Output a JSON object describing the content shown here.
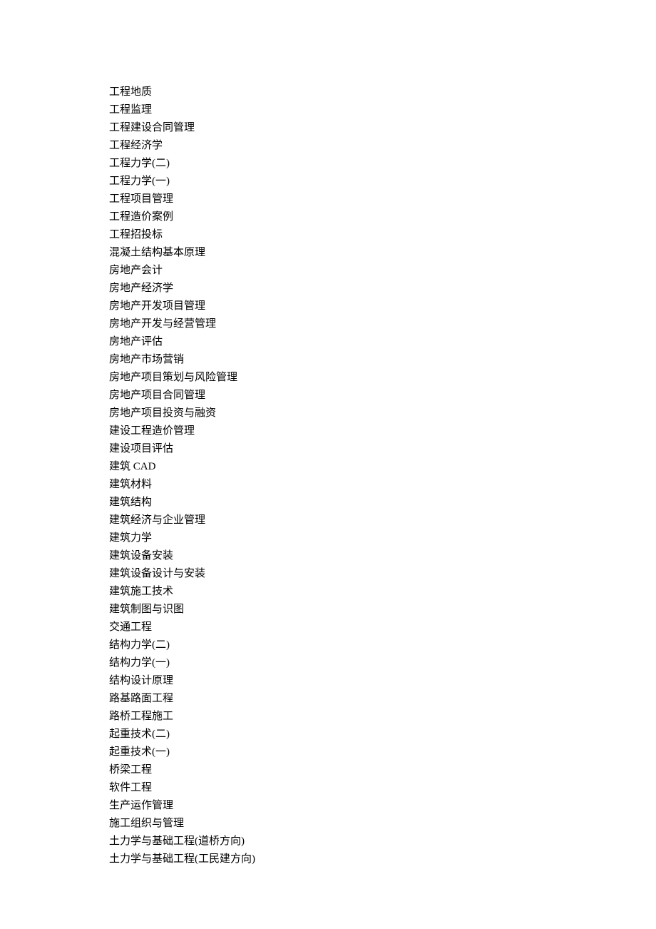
{
  "courses": [
    "工程地质",
    "工程监理",
    "工程建设合同管理",
    "工程经济学",
    "工程力学(二)",
    "工程力学(一)",
    "工程项目管理",
    "工程造价案例",
    "工程招投标",
    "混凝土结构基本原理",
    "房地产会计",
    "房地产经济学",
    "房地产开发项目管理",
    "房地产开发与经营管理",
    "房地产评估",
    "房地产市场营销",
    "房地产项目策划与风险管理",
    "房地产项目合同管理",
    "房地产项目投资与融资",
    "建设工程造价管理",
    "建设项目评估",
    "建筑 CAD",
    "建筑材料",
    "建筑结构",
    "建筑经济与企业管理",
    "建筑力学",
    "建筑设备安装",
    "建筑设备设计与安装",
    "建筑施工技术",
    "建筑制图与识图",
    "交通工程",
    "结构力学(二)",
    "结构力学(一)",
    "结构设计原理",
    "路基路面工程",
    "路桥工程施工",
    "起重技术(二)",
    "起重技术(一)",
    "桥梁工程",
    "软件工程",
    "生产运作管理",
    "施工组织与管理",
    "土力学与基础工程(道桥方向)",
    "土力学与基础工程(工民建方向)"
  ]
}
